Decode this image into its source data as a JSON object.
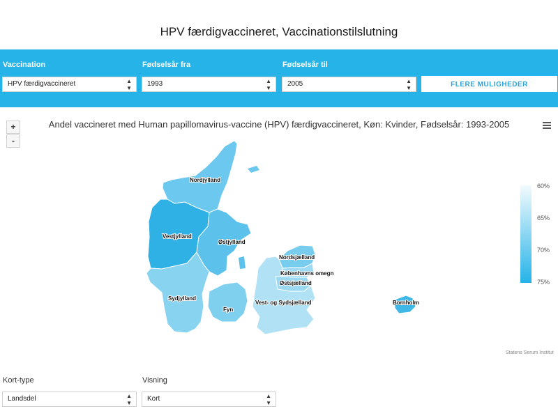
{
  "page": {
    "title": "HPV færdigvaccineret, Vaccinationstilslutning"
  },
  "filters": {
    "vaccination_label": "Vaccination",
    "vaccination_value": "HPV færdigvaccineret",
    "from_label": "Fødselsår fra",
    "from_value": "1993",
    "to_label": "Fødselsår til",
    "to_value": "2005",
    "more_button": "FLERE MULIGHEDER"
  },
  "map": {
    "title": "Andel vaccineret med Human papillomavirus-vaccine (HPV) færdigvaccineret, Køn: Kvinder, Fødselsår: 1993-2005",
    "zoom_in": "+",
    "zoom_out": "-",
    "credit": "Statens Serum Institut",
    "legend": {
      "labels": [
        "60%",
        "65%",
        "70%",
        "75%"
      ],
      "color_low": "#f2fafd",
      "color_high": "#25b3e8"
    },
    "regions": [
      {
        "name": "Nordjylland",
        "color": "#6cc8ee"
      },
      {
        "name": "Vestjylland",
        "color": "#2fb1e6"
      },
      {
        "name": "Østjylland",
        "color": "#5cc2ec"
      },
      {
        "name": "Sydjylland",
        "color": "#88d3f0"
      },
      {
        "name": "Fyn",
        "color": "#7fcfef"
      },
      {
        "name": "Nordsjælland",
        "color": "#78cdef"
      },
      {
        "name": "Københavns omegn",
        "color": "#9edaf3"
      },
      {
        "name": "Østsjælland",
        "color": "#9bd9f3"
      },
      {
        "name": "Vest- og Sydsjælland",
        "color": "#b0e1f5"
      },
      {
        "name": "Bornholm",
        "color": "#3fb8e8"
      }
    ]
  },
  "bottom": {
    "map_type_label": "Kort-type",
    "map_type_value": "Landsdel",
    "view_label": "Visning",
    "view_value": "Kort"
  }
}
